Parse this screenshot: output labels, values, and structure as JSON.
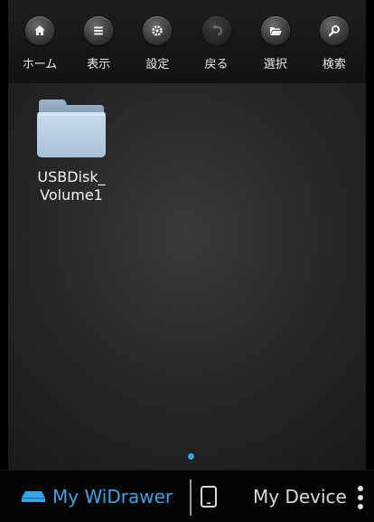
{
  "toolbar": {
    "items": [
      {
        "label": "ホーム",
        "icon": "home-icon"
      },
      {
        "label": "表示",
        "icon": "list-view-icon"
      },
      {
        "label": "設定",
        "icon": "gear-icon"
      },
      {
        "label": "戻る",
        "icon": "back-arrow-icon"
      },
      {
        "label": "選択",
        "icon": "folder-open-icon"
      },
      {
        "label": "検索",
        "icon": "search-icon"
      }
    ]
  },
  "files": [
    {
      "name": "USBDisk_\nVolume1",
      "type": "folder"
    }
  ],
  "bottom_bar": {
    "widrawer_label": "My WiDrawer",
    "device_label": "My Device",
    "active_tab": "My WiDrawer",
    "accent_color": "#3aa3e6"
  }
}
